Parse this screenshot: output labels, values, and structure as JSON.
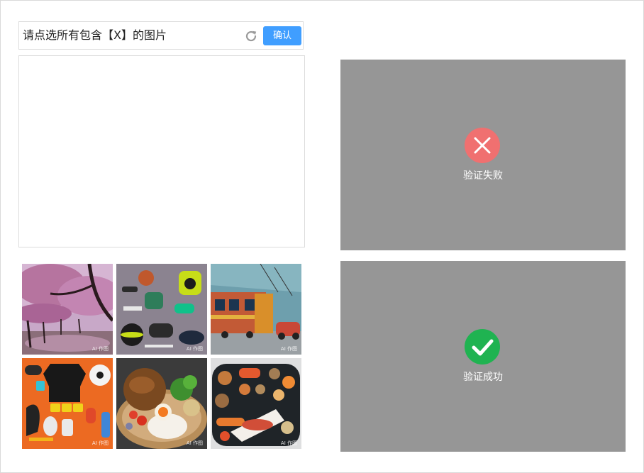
{
  "captcha": {
    "prompt": "请点选所有包含【X】的图片",
    "confirm_label": "确认"
  },
  "grid": {
    "tiles": [
      {
        "badge": "AI 作图"
      },
      {
        "badge": "AI 作图"
      },
      {
        "badge": "AI 作图"
      },
      {
        "badge": "AI 作图"
      },
      {
        "badge": "AI 作图"
      },
      {
        "badge": "AI 作图"
      }
    ]
  },
  "status": {
    "fail_text": "验证失败",
    "success_text": "验证成功"
  },
  "colors": {
    "accent": "#409eff",
    "fail": "#f07070",
    "success": "#1fb351",
    "overlay": "#969696"
  }
}
